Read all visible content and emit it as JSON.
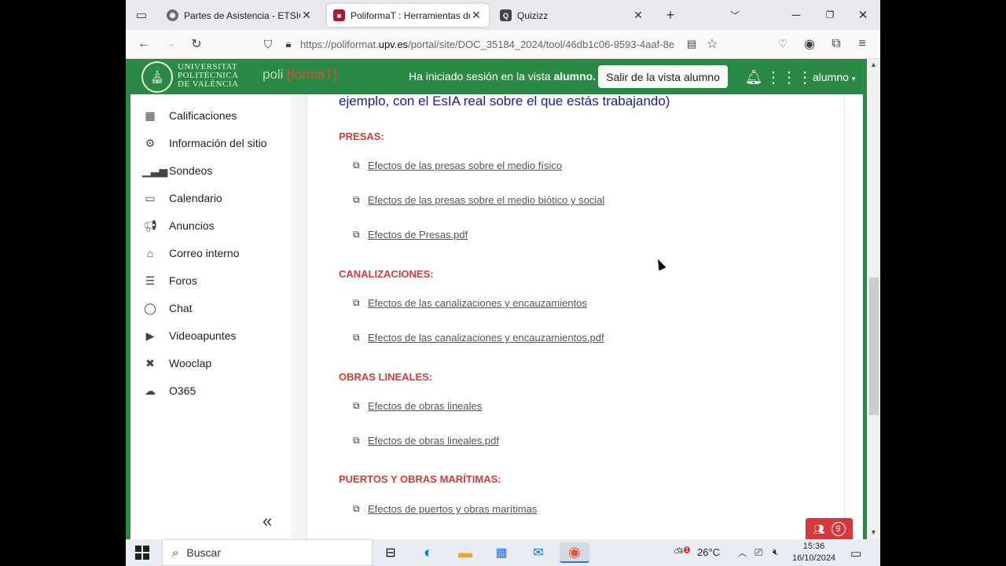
{
  "browser": {
    "tabs": [
      {
        "title": "Partes de Asistencia - ETSICCP",
        "close": "✕"
      },
      {
        "title": "PoliformaT : Herramientas de e",
        "close": "✕"
      },
      {
        "title": "Quizizz",
        "close": "✕"
      }
    ],
    "new_tab": "+",
    "url_prefix": "https://poliformat.",
    "url_domain": "upv.es",
    "url_rest": "/portal/site/DOC_35184_2024/tool/46db1c06-9593-4aaf-8e"
  },
  "site": {
    "logo_lines": [
      "UNIVERSITAT",
      "POLITÈCNICA",
      "DE VALÈNCIA"
    ],
    "poli": "poli",
    "formaT": "[formaT]",
    "session_prefix": "Ha iniciado sesión en la vista",
    "session_role": "alumno.",
    "exit_button": "Salir de la vista alumno",
    "user": "alumno"
  },
  "sidebar": {
    "items": [
      {
        "label": "Calificaciones",
        "icon": "grades-icon"
      },
      {
        "label": "Información del sitio",
        "icon": "gear-icon"
      },
      {
        "label": "Sondeos",
        "icon": "bar-chart-icon"
      },
      {
        "label": "Calendario",
        "icon": "calendar-icon"
      },
      {
        "label": "Anuncios",
        "icon": "megaphone-icon"
      },
      {
        "label": "Correo interno",
        "icon": "mail-tray-icon"
      },
      {
        "label": "Foros",
        "icon": "forum-icon"
      },
      {
        "label": "Chat",
        "icon": "chat-icon"
      },
      {
        "label": "Videoapuntes",
        "icon": "video-icon"
      },
      {
        "label": "Wooclap",
        "icon": "wooclap-icon"
      },
      {
        "label": "O365",
        "icon": "cloud-icon"
      }
    ],
    "collapse": "«"
  },
  "content": {
    "intro": "ejemplo, con el EsIA real sobre el que estás trabajando)",
    "sections": [
      {
        "heading": "PRESAS:",
        "links": [
          "Efectos de las presas sobre el medio físico",
          "Efectos de las presas sobre el medio biótico y social",
          "Efectos de Presas.pdf"
        ]
      },
      {
        "heading": "CANALIZACIONES:",
        "links": [
          "Efectos de las canalizaciones y encauzamientos",
          "Efectos de las canalizaciones y encauzamientos.pdf"
        ]
      },
      {
        "heading": "OBRAS LINEALES:",
        "links": [
          "Efectos de obras lineales",
          "Efectos de obras lineales.pdf"
        ]
      },
      {
        "heading": "PUERTOS Y OBRAS MARÍTIMAS:",
        "links": [
          "Efectos de puertos y obras marítimas"
        ]
      }
    ]
  },
  "chat_badge": {
    "count": "9"
  },
  "taskbar": {
    "search": "Buscar",
    "weather": "26°C",
    "time": "15:36",
    "date": "16/10/2024",
    "weather_badge": "1"
  },
  "colors": {
    "green": "#2a8a45",
    "red": "#d9383a",
    "intro_blue": "#1a1aa6"
  }
}
